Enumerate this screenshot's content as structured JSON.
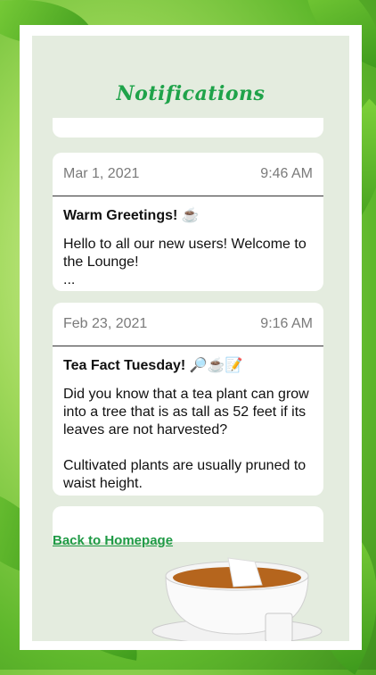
{
  "page": {
    "title": "Notifications"
  },
  "notifications": [
    {
      "date": "Mar 1, 2021",
      "time": "9:46 AM",
      "title": "Warm Greetings! ☕",
      "message": "Hello to all our new users! Welcome to the Lounge!\n..."
    },
    {
      "date": "Feb 23, 2021",
      "time": "9:16 AM",
      "title": "Tea Fact Tuesday! 🔎☕📝",
      "message": "Did you know that a tea plant can grow into a tree that is as tall as 52 feet if its leaves are not harvested?\n\nCultivated plants are usually pruned to waist height."
    }
  ],
  "footer": {
    "back_link": "Back to Homepage"
  },
  "colors": {
    "accent": "#1fa34a",
    "card_bg": "#ffffff",
    "panel_bg": "#e4ecdf"
  }
}
